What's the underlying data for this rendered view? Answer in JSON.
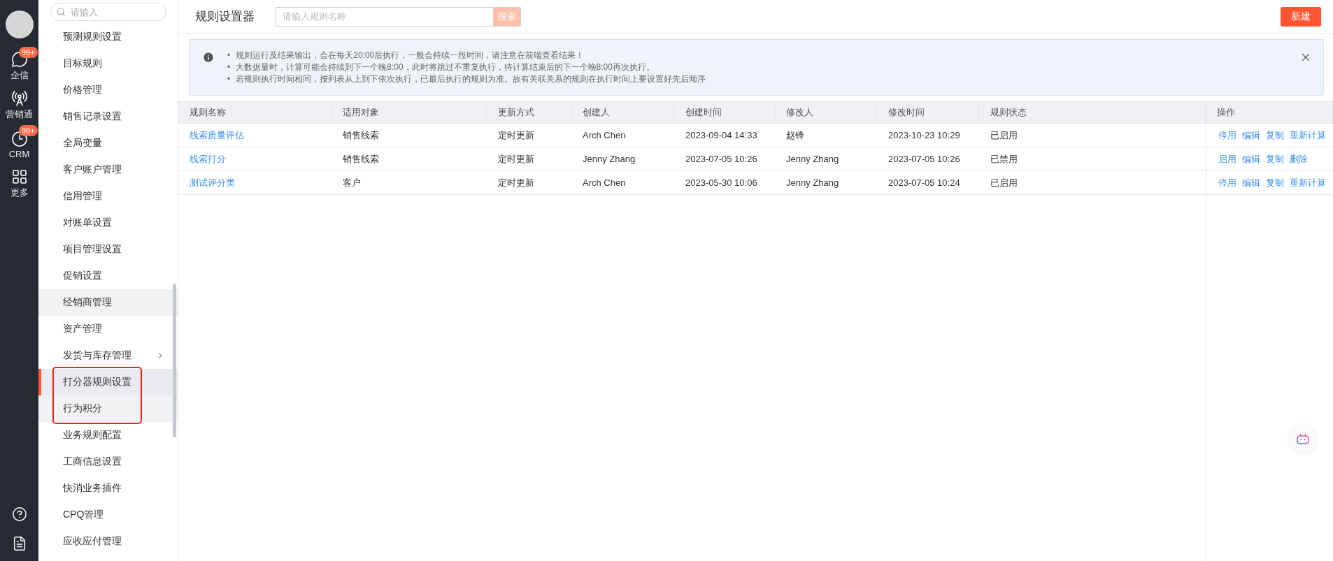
{
  "rail": {
    "items": [
      {
        "label": "企信",
        "badge": "99+",
        "kind": "chat"
      },
      {
        "label": "营销通",
        "kind": "broadcast"
      },
      {
        "label": "CRM",
        "badge": "99+",
        "kind": "clock"
      },
      {
        "label": "更多",
        "kind": "grid"
      }
    ],
    "bottom": [
      {
        "kind": "help"
      },
      {
        "kind": "document"
      }
    ]
  },
  "nav": {
    "search_placeholder": "请输入",
    "items": [
      {
        "label": "预测规则设置",
        "selected": false,
        "shaded": false,
        "highlighted": false,
        "has_children": false
      },
      {
        "label": "目标规则",
        "selected": false,
        "shaded": false,
        "highlighted": false,
        "has_children": false
      },
      {
        "label": "价格管理",
        "selected": false,
        "shaded": false,
        "highlighted": false,
        "has_children": false
      },
      {
        "label": "销售记录设置",
        "selected": false,
        "shaded": false,
        "highlighted": false,
        "has_children": false
      },
      {
        "label": "全局变量",
        "selected": false,
        "shaded": false,
        "highlighted": false,
        "has_children": false
      },
      {
        "label": "客户账户管理",
        "selected": false,
        "shaded": false,
        "highlighted": false,
        "has_children": false
      },
      {
        "label": "信用管理",
        "selected": false,
        "shaded": false,
        "highlighted": false,
        "has_children": false
      },
      {
        "label": "对账单设置",
        "selected": false,
        "shaded": false,
        "highlighted": false,
        "has_children": false
      },
      {
        "label": "项目管理设置",
        "selected": false,
        "shaded": false,
        "highlighted": false,
        "has_children": false
      },
      {
        "label": "促销设置",
        "selected": false,
        "shaded": false,
        "highlighted": false,
        "has_children": false
      },
      {
        "label": "经销商管理",
        "selected": false,
        "shaded": true,
        "highlighted": false,
        "has_children": false
      },
      {
        "label": "资产管理",
        "selected": false,
        "shaded": false,
        "highlighted": false,
        "has_children": false
      },
      {
        "label": "发货与库存管理",
        "selected": false,
        "shaded": false,
        "highlighted": false,
        "has_children": true
      },
      {
        "label": "打分器规则设置",
        "selected": true,
        "shaded": false,
        "highlighted": true,
        "has_children": false
      },
      {
        "label": "行为积分",
        "selected": false,
        "shaded": true,
        "highlighted": true,
        "has_children": false
      },
      {
        "label": "业务规则配置",
        "selected": false,
        "shaded": false,
        "highlighted": false,
        "has_children": false
      },
      {
        "label": "工商信息设置",
        "selected": false,
        "shaded": false,
        "highlighted": false,
        "has_children": false
      },
      {
        "label": "快消业务插件",
        "selected": false,
        "shaded": false,
        "highlighted": false,
        "has_children": false
      },
      {
        "label": "CPQ管理",
        "selected": false,
        "shaded": false,
        "highlighted": false,
        "has_children": false
      },
      {
        "label": "应收应付管理",
        "selected": false,
        "shaded": false,
        "highlighted": false,
        "has_children": false
      }
    ]
  },
  "header": {
    "title": "规则设置器",
    "search_placeholder": "请输入规则名称",
    "search_button": "搜索",
    "new_button": "新建"
  },
  "notice": {
    "bullet": "•",
    "lines": [
      "规则运行及结果输出，会在每天20:00后执行，一般会持续一段时间，请注意在前端查看结果！",
      "大数据量时，计算可能会持续到下一个晚8:00，此时将跳过不重复执行，待计算结束后的下一个晚8:00再次执行。",
      "若规则执行时间相同，按列表从上到下依次执行，已最后执行的规则为准。故有关联关系的规则在执行时间上要设置好先后顺序"
    ]
  },
  "table": {
    "columns": [
      "规则名称",
      "适用对象",
      "更新方式",
      "创建人",
      "创建时间",
      "修改人",
      "修改时间",
      "规则状态",
      "操作"
    ],
    "rows": [
      {
        "name": "线索质量评估",
        "target": "销售线索",
        "update": "定时更新",
        "creator": "Arch Chen",
        "created": "2023-09-04 14:33",
        "modifier": "赵锋",
        "modified": "2023-10-23 10:29",
        "status": "已启用",
        "actions": [
          "停用",
          "编辑",
          "复制",
          "重新计算"
        ]
      },
      {
        "name": "线索打分",
        "target": "销售线索",
        "update": "定时更新",
        "creator": "Jenny Zhang",
        "created": "2023-07-05 10:26",
        "modifier": "Jenny Zhang",
        "modified": "2023-07-05 10:26",
        "status": "已禁用",
        "actions": [
          "启用",
          "编辑",
          "复制",
          "删除"
        ]
      },
      {
        "name": "测试评分类",
        "target": "客户",
        "update": "定时更新",
        "creator": "Arch Chen",
        "created": "2023-05-30 10:06",
        "modifier": "Jenny Zhang",
        "modified": "2023-07-05 10:24",
        "status": "已启用",
        "actions": [
          "停用",
          "编辑",
          "复制",
          "重新计算"
        ]
      }
    ]
  }
}
